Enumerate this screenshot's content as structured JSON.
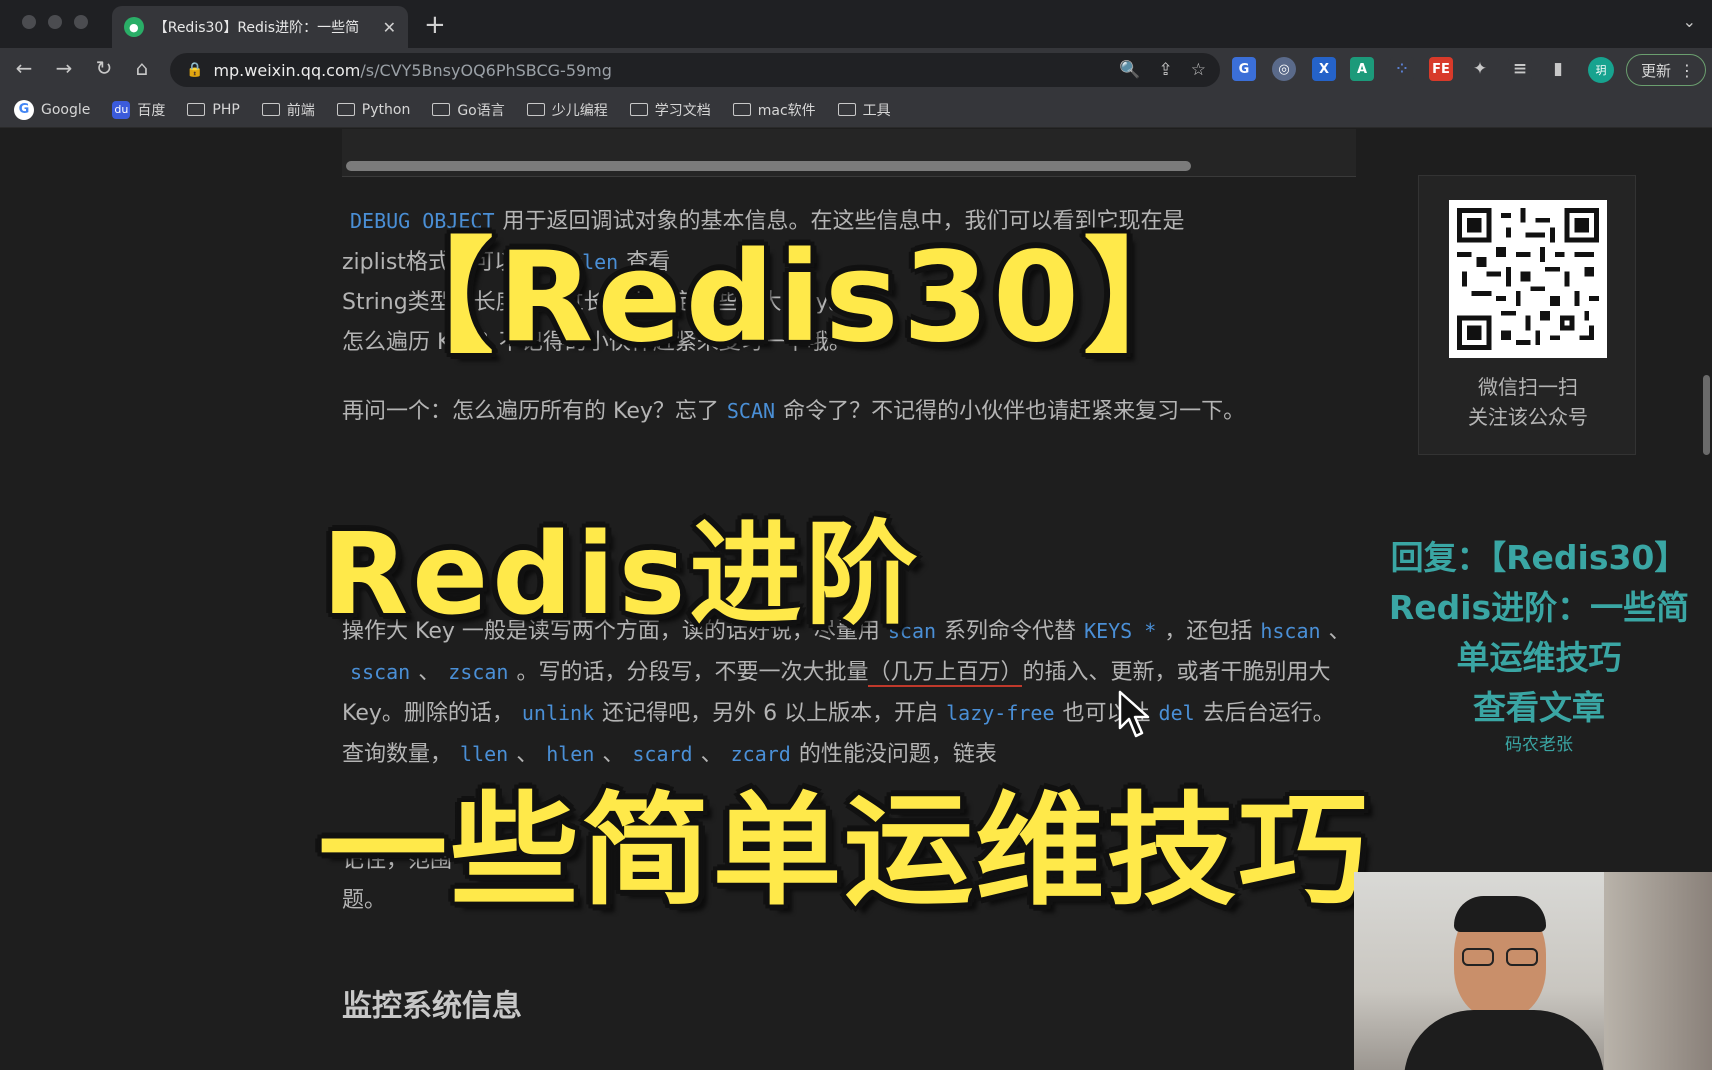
{
  "browser": {
    "tab_title": "【Redis30】Redis进阶：一些简",
    "url_host": "mp.weixin.qq.com",
    "url_path": "/s/CVY5BnsyOQ6PhSBCG-59mg",
    "update_label": "更新",
    "profile_initial": "玥",
    "bookmarks": [
      "Google",
      "百度",
      "PHP",
      "前端",
      "Python",
      "Go语言",
      "少儿编程",
      "学习文档",
      "mac软件",
      "工具"
    ]
  },
  "article": {
    "p1_seg1": "DEBUG OBJECT",
    "p1_seg2": "用于返回调试对象的基本信息。在这些信息中，我们可以看到它现在是",
    "p1_seg3": "ziplist格式",
    "p1_seg4": "，可以用",
    "p1_seg5": "strlen",
    "p1_seg6": "查看",
    "p1_seg7": "String类型的长度，通过长度来确定哪些是大 Key。",
    "p1_seg8": "怎么遍历 Key？不记得的小伙伴赶紧来复习一下哦。",
    "p2_seg1": "再问一个：怎么遍历所有的 Key？忘了",
    "p2_code": "SCAN",
    "p2_seg2": "命令了？不记得的小伙伴也请赶紧来复习一下。",
    "p3_seg1": "操作大 Key 一般是读写两个方面，读的话好说，尽量用",
    "p3_code1": "scan",
    "p3_seg2": "系列命令代替",
    "p3_code2": "KEYS *",
    "p3_seg3": "，还包括",
    "p3_code3": "hscan",
    "p3_sep1": "、",
    "p3_code4": "sscan",
    "p3_sep2": "、",
    "p3_code5": "zscan",
    "p3_seg4": "。写的话，分段写，不要一次大批量",
    "p3_underlined": "（几万上百万）",
    "p3_seg5": "的插入、更新，或者干脆别用大 Key。删除的话，",
    "p3_code6": "unlink",
    "p3_seg6": "还记得吧，另外 6 以上版本，开启",
    "p3_code7": "lazy-free",
    "p3_seg7": "也可以让",
    "p3_code8": "del",
    "p3_seg8": "去后台运行。查询数量，",
    "p3_code9": "llen",
    "p3_sep3": "、",
    "p3_code10": "hlen",
    "p3_sep4": "、",
    "p3_code11": "scard",
    "p3_sep5": "、",
    "p3_code12": "zcard",
    "p3_seg9": "的性能没问题，链表",
    "p4_seg1": "记住，范围",
    "p4_seg2": "题。",
    "h2": "监控系统信息"
  },
  "sidebar": {
    "qr_caption_1": "微信扫一扫",
    "qr_caption_2": "关注该公众号",
    "promo_1": "回复：【Redis30】",
    "promo_2": "Redis进阶：一些简",
    "promo_3": "单运维技巧",
    "promo_4": "查看文章",
    "promo_author": "码农老张"
  },
  "overlay": {
    "line1": "【Redis30】",
    "line2": "Redis进阶",
    "line3": "一些简单运维技巧"
  },
  "colors": {
    "overlay_yellow": "#ffe94a",
    "code_blue": "#4a8fd6",
    "promo_teal": "#3aa6a4"
  }
}
